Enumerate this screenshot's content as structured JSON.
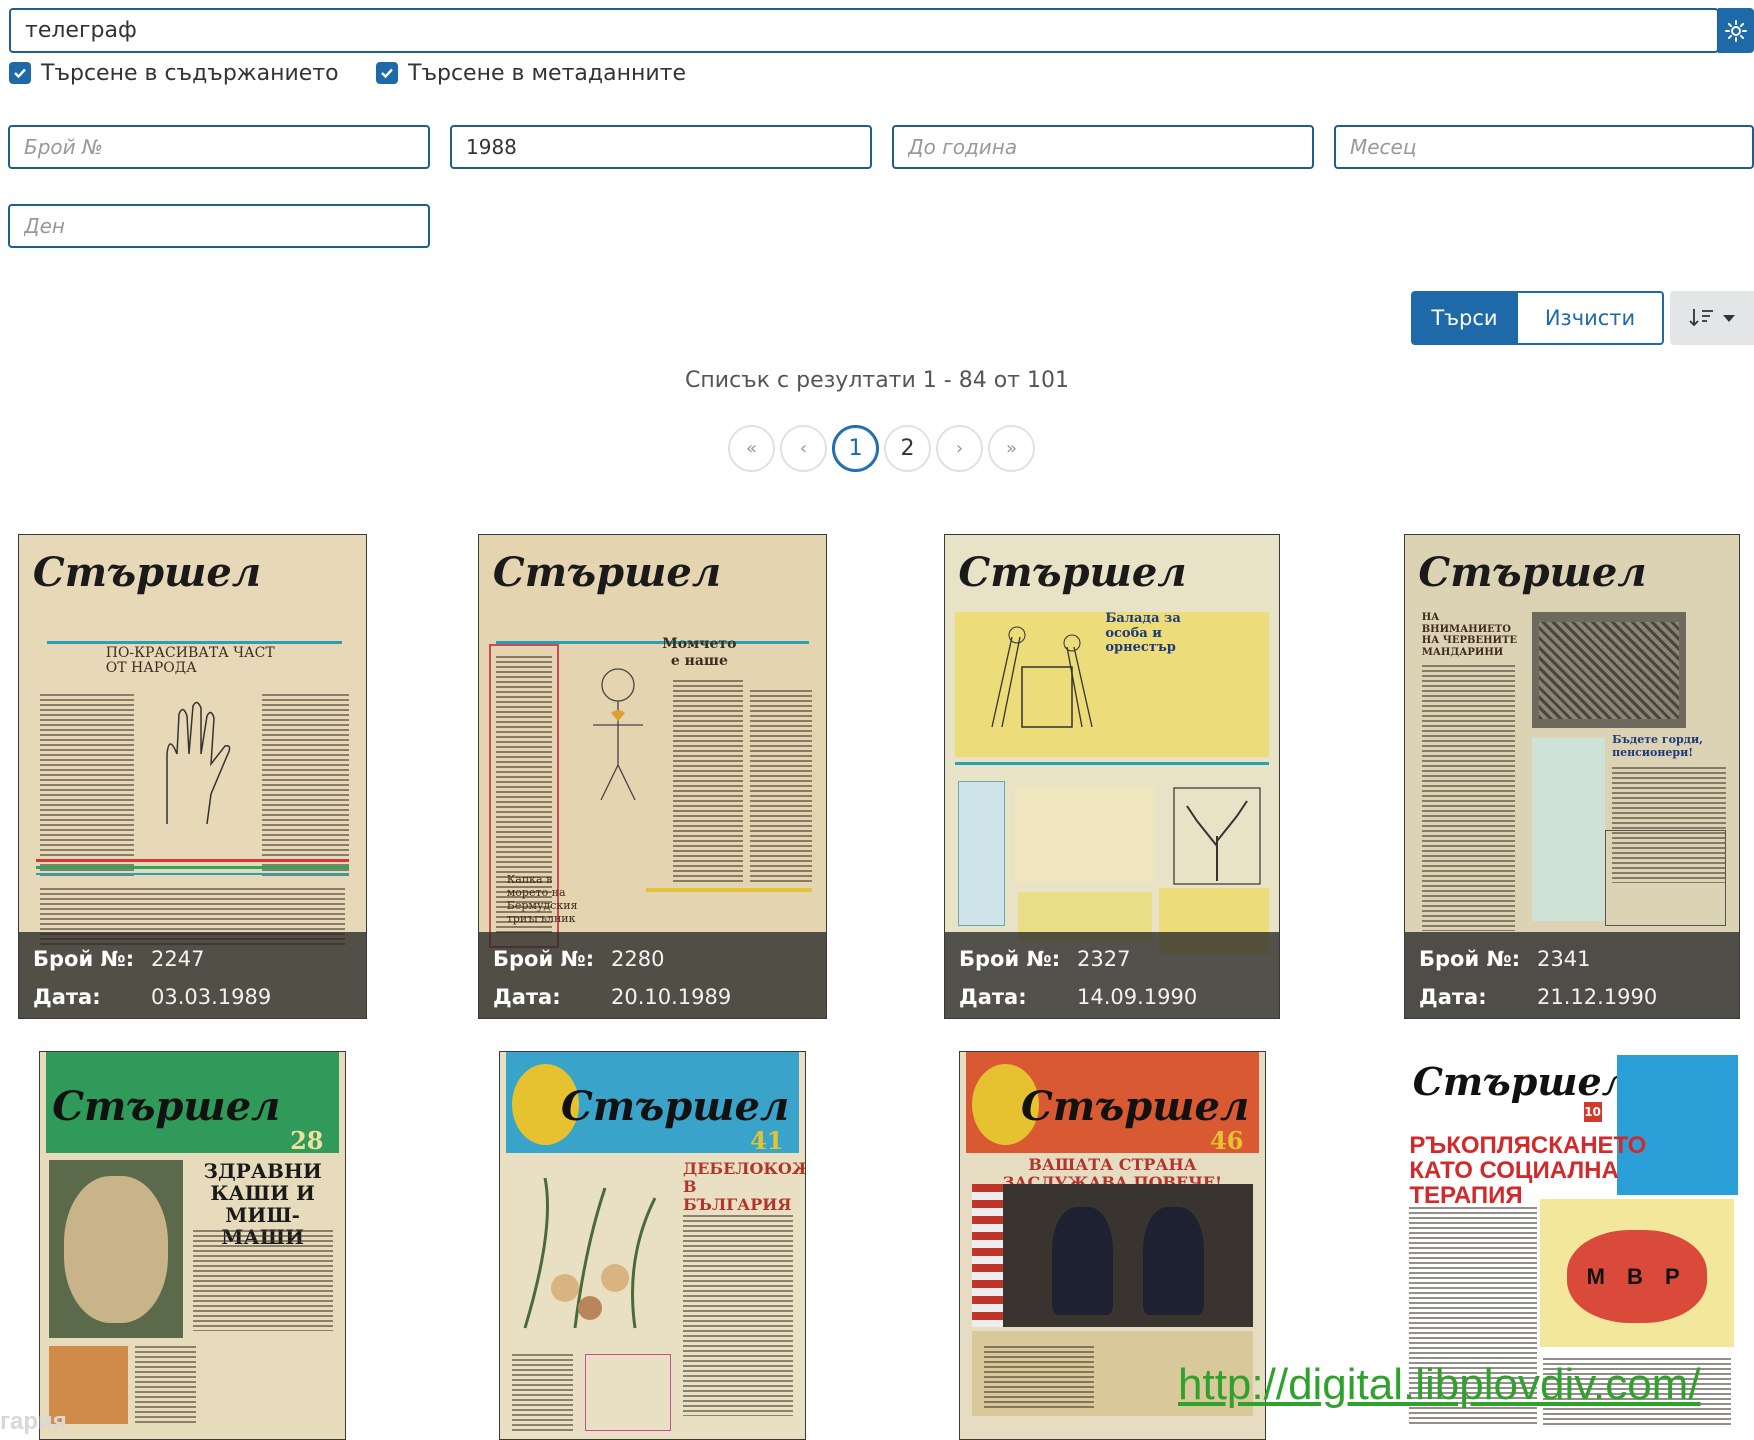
{
  "search": {
    "value": "телеграф"
  },
  "options": {
    "content_label": "Търсене в съдържанието",
    "metadata_label": "Търсене в метаданните"
  },
  "filters": {
    "issue_placeholder": "Брой №",
    "year_value": "1988",
    "to_year_placeholder": "До година",
    "month_placeholder": "Месец",
    "day_placeholder": "Ден"
  },
  "actions": {
    "search_label": "Търси",
    "clear_label": "Изчисти"
  },
  "results": {
    "summary": "Списък с резултати 1 - 84 от 101"
  },
  "pagination": {
    "first": "«",
    "prev": "‹",
    "pages": [
      "1",
      "2"
    ],
    "next": "›",
    "last": "»",
    "current": "1"
  },
  "cards": [
    {
      "masthead": "Стършел",
      "number_label": "Брой №:",
      "number": "2247",
      "date_label": "Дата:",
      "date": "03.03.1989",
      "headline": "ПО-КРАСИВАТА ЧАСТ ОТ НАРОДА"
    },
    {
      "masthead": "Стършел",
      "number_label": "Брой №:",
      "number": "2280",
      "date_label": "Дата:",
      "date": "20.10.1989",
      "headline": "Момчето е наше"
    },
    {
      "masthead": "Стършел",
      "number_label": "Брой №:",
      "number": "2327",
      "date_label": "Дата:",
      "date": "14.09.1990",
      "headline": "Балада за особа и орнестър"
    },
    {
      "masthead": "Стършел",
      "number_label": "Брой №:",
      "number": "2341",
      "date_label": "Дата:",
      "date": "21.12.1990",
      "headline": "НА ВНИМАНИЕТО НА ЧЕРВЕНИТЕ МАНДАРИНИ"
    },
    {
      "masthead": "Стършел",
      "headline": "ЗДРАВНИ КАШИ И МИШ-МАШИ",
      "issue_mark": "28"
    },
    {
      "masthead": "Стършел",
      "headline": "ДЕБЕЛОКОЖИТЕ В БЪЛГАРИЯ",
      "issue_mark": "41"
    },
    {
      "masthead": "Стършел",
      "headline": "ВАШАТА СТРАНА ЗАСЛУЖАВА ПОВЕЧЕ!",
      "issue_mark": "46"
    },
    {
      "masthead": "Стършел",
      "headline": "РЪКОПЛЯСКАНЕТО КАТО СОЦИАЛНА ТЕРАПИЯ",
      "issue_mark": "10",
      "balloon_text": "М В Р"
    }
  ],
  "watermark": "http://digital.libplovdiv.com/",
  "corner_text": "гария",
  "colors": {
    "accent": "#1e6aa8",
    "watermark": "#2fa12c"
  }
}
